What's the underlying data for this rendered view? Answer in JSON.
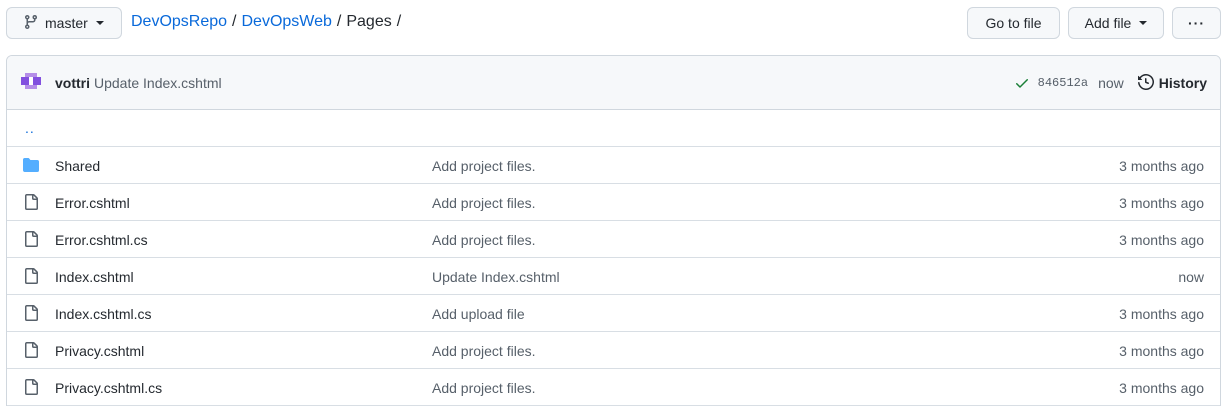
{
  "branch": {
    "name": "master"
  },
  "breadcrumb": {
    "repo": "DevOpsRepo",
    "folder": "DevOpsWeb",
    "current": "Pages",
    "sep": "/"
  },
  "actions": {
    "goto_label": "Go to file",
    "addfile_label": "Add file",
    "more_label": "···"
  },
  "commit": {
    "author": "vottri",
    "message": "Update Index.cshtml",
    "sha": "846512a",
    "time": "now",
    "history_label": "History"
  },
  "parent_dir": "..",
  "files": [
    {
      "name": "Shared",
      "type": "folder",
      "message": "Add project files.",
      "age": "3 months ago"
    },
    {
      "name": "Error.cshtml",
      "type": "file",
      "message": "Add project files.",
      "age": "3 months ago"
    },
    {
      "name": "Error.cshtml.cs",
      "type": "file",
      "message": "Add project files.",
      "age": "3 months ago"
    },
    {
      "name": "Index.cshtml",
      "type": "file",
      "message": "Update Index.cshtml",
      "age": "now"
    },
    {
      "name": "Index.cshtml.cs",
      "type": "file",
      "message": "Add upload file",
      "age": "3 months ago"
    },
    {
      "name": "Privacy.cshtml",
      "type": "file",
      "message": "Add project files.",
      "age": "3 months ago"
    },
    {
      "name": "Privacy.cshtml.cs",
      "type": "file",
      "message": "Add project files.",
      "age": "3 months ago"
    }
  ],
  "colors": {
    "link": "#0969da",
    "folder": "#54aeff",
    "success": "#1a7f37",
    "avatar": "#8250df"
  }
}
